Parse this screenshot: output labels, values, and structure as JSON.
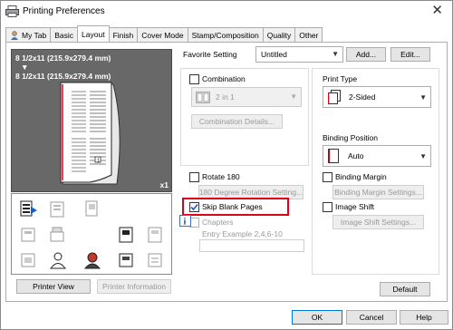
{
  "window": {
    "title": "Printing Preferences",
    "close_glyph": "✕"
  },
  "tabs": [
    {
      "label": "My Tab"
    },
    {
      "label": "Basic"
    },
    {
      "label": "Layout",
      "active": true
    },
    {
      "label": "Finish"
    },
    {
      "label": "Cover Mode"
    },
    {
      "label": "Stamp/Composition"
    },
    {
      "label": "Quality"
    },
    {
      "label": "Other"
    }
  ],
  "preview": {
    "paper_line1": "8 1/2x11 (215.9x279.4 mm)",
    "paper_arrow": "▼",
    "paper_line2": "8 1/2x11 (215.9x279.4 mm)",
    "copies_label": "x1",
    "printer_view_label": "Printer View",
    "printer_information_label": "Printer Information"
  },
  "favorite": {
    "label": "Favorite Setting",
    "value": "Untitled",
    "add_label": "Add...",
    "edit_label": "Edit..."
  },
  "combination": {
    "label": "Combination",
    "value": "2 in 1",
    "details_label": "Combination Details..."
  },
  "rotate": {
    "label": "Rotate 180",
    "settings_label": "180 Degree Rotation Setting..."
  },
  "skip_blank": {
    "label": "Skip Blank Pages",
    "checked": true
  },
  "chapters": {
    "label": "Chapters",
    "example": "Entry Example 2,4,6-10"
  },
  "print_type": {
    "label": "Print Type",
    "value": "2-Sided"
  },
  "binding_position": {
    "label": "Binding Position",
    "value": "Auto"
  },
  "binding_margin": {
    "label": "Binding Margin",
    "settings_label": "Binding Margin Settings..."
  },
  "image_shift": {
    "label": "Image Shift",
    "settings_label": "Image Shift Settings..."
  },
  "default_label": "Default",
  "footer": {
    "ok": "OK",
    "cancel": "Cancel",
    "help": "Help"
  },
  "colors": {
    "highlight": "#e0001b",
    "preview_bg": "#686868"
  }
}
